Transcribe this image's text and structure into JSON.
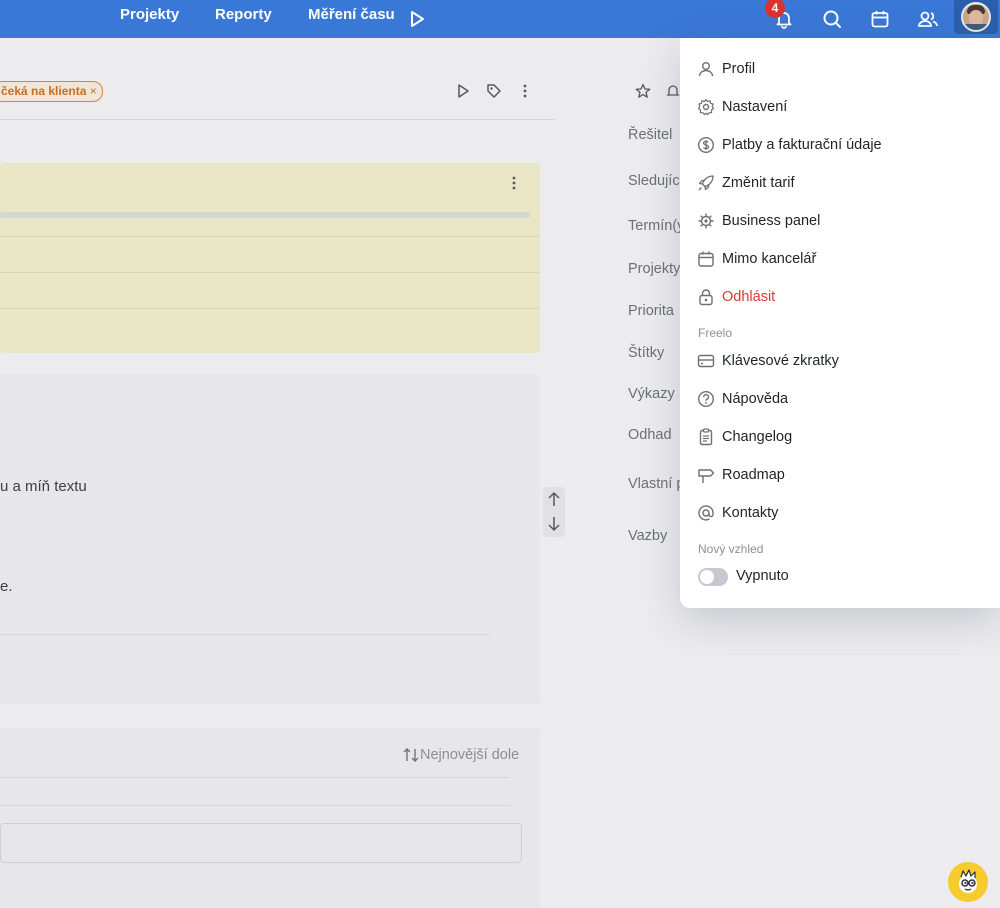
{
  "nav": {
    "projects": "Projekty",
    "reports": "Reporty",
    "time_tracking": "Měření času",
    "notifications_count": "4"
  },
  "task": {
    "status_tag": "čeká na klienta",
    "description_fragment_1": "u a míň textu",
    "description_fragment_2": "e.",
    "sort_label": "Nejnovější dole"
  },
  "sidebar_labels": [
    "Řešitel",
    "Sledujíc",
    "Termín(y",
    "Projekty",
    "Priorita",
    "Štítky",
    "Výkazy",
    "Odhad",
    "Vlastní p",
    "Vazby"
  ],
  "menu": {
    "items": [
      {
        "label": "Profil",
        "icon": "user-icon"
      },
      {
        "label": "Nastavení",
        "icon": "gear-icon"
      },
      {
        "label": "Platby a fakturační údaje",
        "icon": "dollar-icon"
      },
      {
        "label": "Změnit tarif",
        "icon": "rocket-icon"
      },
      {
        "label": "Business panel",
        "icon": "settings-cog-icon"
      },
      {
        "label": "Mimo kancelář",
        "icon": "calendar-icon"
      },
      {
        "label": "Odhlásit",
        "icon": "lock-icon"
      }
    ],
    "section_freelo": "Freelo",
    "freelo_items": [
      {
        "label": "Klávesové zkratky",
        "icon": "keyboard-icon"
      },
      {
        "label": "Nápověda",
        "icon": "help-icon"
      },
      {
        "label": "Changelog",
        "icon": "clipboard-icon"
      },
      {
        "label": "Roadmap",
        "icon": "signpost-icon"
      },
      {
        "label": "Kontakty",
        "icon": "at-icon"
      }
    ],
    "section_new_look": "Nový vzhled",
    "toggle_label": "Vypnuto",
    "toggle_on": false
  },
  "colors": {
    "topbar": "#3a78d8",
    "danger": "#d83a34",
    "tag": "#d7853a"
  }
}
